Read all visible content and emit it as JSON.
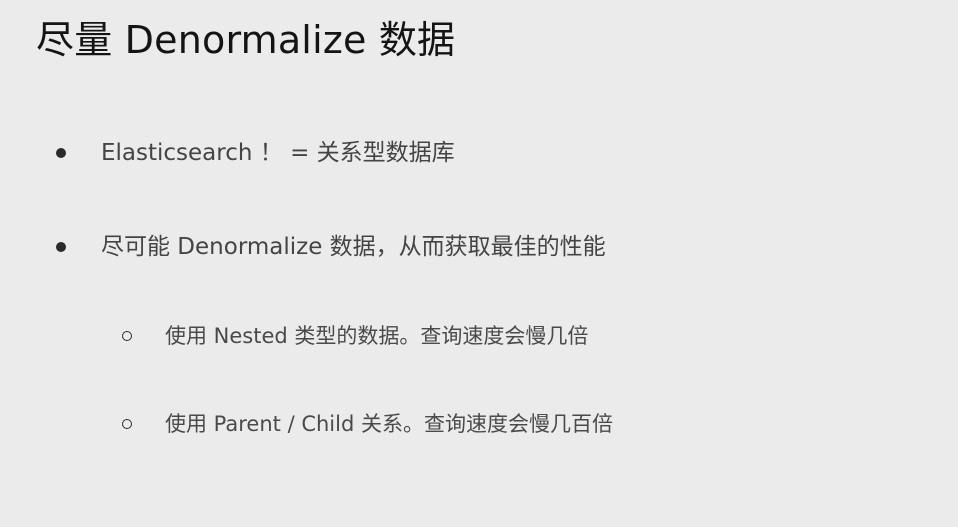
{
  "slide": {
    "title": "尽量 Denormalize 数据",
    "bullets": [
      {
        "level": 1,
        "marker": "bullet-disc-icon",
        "text": "Elasticsearch ！ = 关系型数据库"
      },
      {
        "level": 1,
        "marker": "bullet-disc-icon",
        "text": "尽可能 Denormalize 数据，从而获取最佳的性能"
      },
      {
        "level": 2,
        "marker": "bullet-circle-icon",
        "text": "使用 Nested 类型的数据。查询速度会慢几倍"
      },
      {
        "level": 2,
        "marker": "bullet-circle-icon",
        "text": "使用 Parent / Child 关系。查询速度会慢几百倍"
      }
    ]
  },
  "colors": {
    "background": "#ebebeb",
    "title_text": "#141414",
    "body_text": "#444444"
  }
}
